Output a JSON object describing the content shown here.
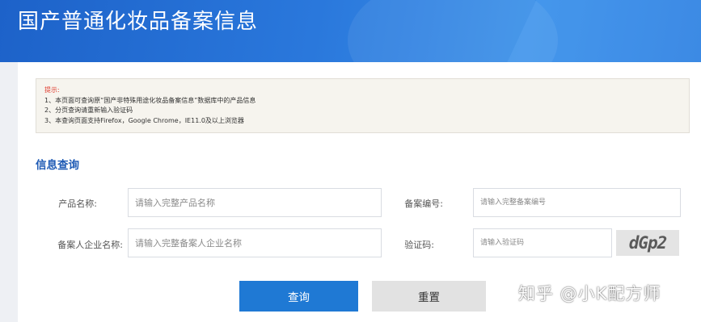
{
  "header": {
    "title": "国产普通化妆品备案信息"
  },
  "notice": {
    "title": "提示:",
    "lines": [
      "1、本页面可查询原“国产非特殊用途化妆品备案信息”数据库中的产品信息",
      "2、分页查询请重新输入验证码",
      "3、本查询页面支持Firefox，Google Chrome，IE11.0及以上浏览器"
    ]
  },
  "search": {
    "section_title": "信息查询",
    "product_name": {
      "label": "产品名称:",
      "placeholder": "请输入完整产品名称",
      "value": ""
    },
    "record_number": {
      "label": "备案编号:",
      "placeholder": "请输入完整备案编号",
      "value": ""
    },
    "company_name": {
      "label": "备案人企业名称:",
      "placeholder": "请输入完整备案人企业名称",
      "value": ""
    },
    "captcha": {
      "label": "验证码:",
      "placeholder": "请输入验证码",
      "value": "",
      "image_text": "dGp2"
    },
    "query_label": "查询",
    "reset_label": "重置"
  },
  "watermark": "知乎 @小K配方师",
  "colors": {
    "header_blue": "#2a78dc",
    "accent_blue": "#1f79d4",
    "section_title": "#1f5bb5",
    "tip_red": "#e03c2f"
  }
}
